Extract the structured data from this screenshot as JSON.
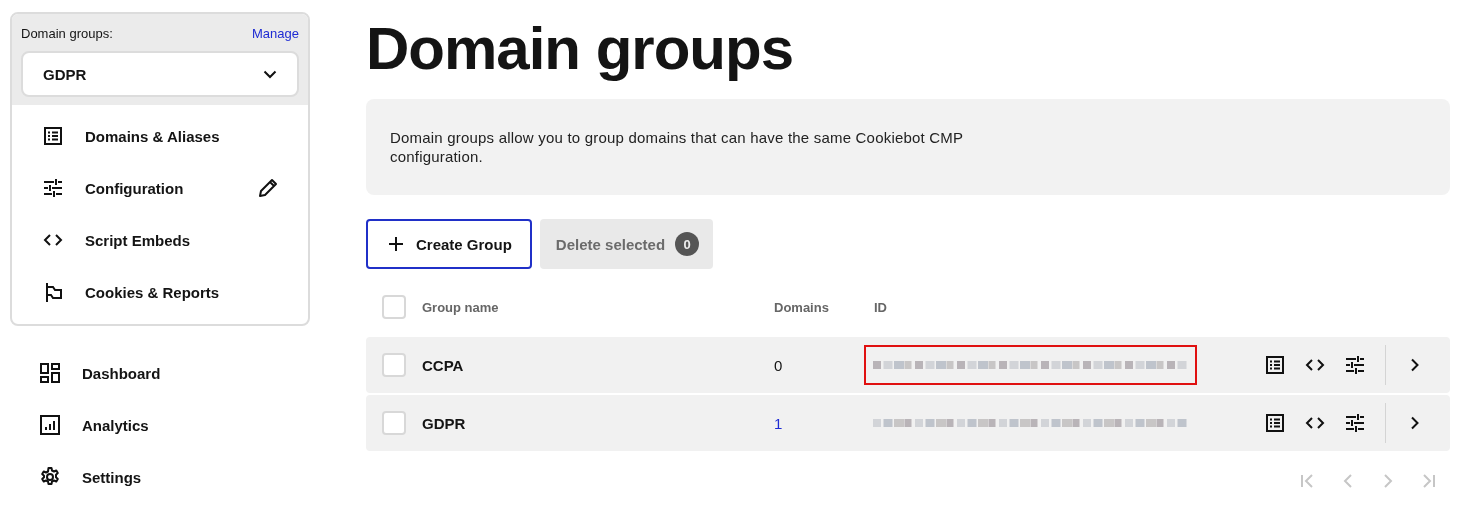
{
  "group_panel": {
    "label": "Domain groups:",
    "manage_link": "Manage",
    "selected_group": "GDPR",
    "items": [
      {
        "label": "Domains & Aliases",
        "kind": "list",
        "editable": false
      },
      {
        "label": "Configuration",
        "kind": "sliders",
        "editable": true
      },
      {
        "label": "Script Embeds",
        "kind": "code",
        "editable": false
      },
      {
        "label": "Cookies & Reports",
        "kind": "flag",
        "editable": false
      }
    ]
  },
  "nav": [
    {
      "label": "Dashboard",
      "kind": "dashboard"
    },
    {
      "label": "Analytics",
      "kind": "chart"
    },
    {
      "label": "Settings",
      "kind": "gear"
    }
  ],
  "title": "Domain groups",
  "info": "Domain groups allow you to group domains that can have the same Cookiebot CMP configuration.",
  "create_button": "Create Group",
  "delete_button": {
    "label": "Delete selected",
    "count": "0",
    "disabled": true
  },
  "table": {
    "select_all": {
      "checked": false
    },
    "columns": [
      "Group name",
      "Domains",
      "ID"
    ],
    "rows": [
      {
        "name": "CCPA",
        "domains": "0",
        "domains_link": false,
        "checked": false,
        "id_highlighted": true
      },
      {
        "name": "GDPR",
        "domains": "1",
        "domains_link": true,
        "checked": false,
        "id_highlighted": false
      }
    ]
  },
  "pagination": [
    {
      "kind": "first",
      "disabled": true
    },
    {
      "kind": "prev",
      "disabled": true
    },
    {
      "kind": "next",
      "disabled": true
    },
    {
      "kind": "last",
      "disabled": true
    }
  ]
}
